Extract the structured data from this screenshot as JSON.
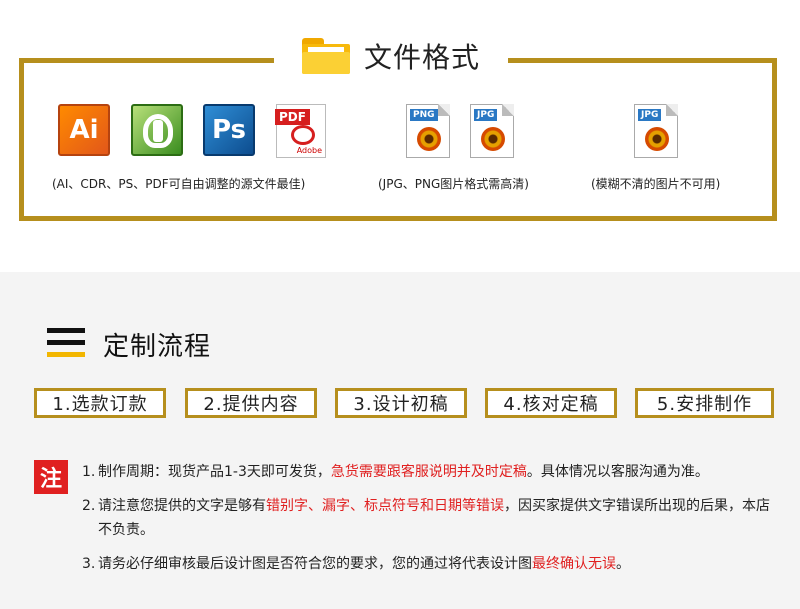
{
  "formats": {
    "title": "文件格式",
    "icons": {
      "ai": "Ai",
      "ps": "Ps",
      "pdf": "PDF",
      "pdf_sub": "Adobe",
      "png1": "PNG",
      "jpg1": "JPG",
      "jpg2": "JPG"
    },
    "captions": [
      "(AI、CDR、PS、PDF可自由调整的源文件最佳)",
      "(JPG、PNG图片格式需高清)",
      "(模糊不清的图片不可用)"
    ]
  },
  "process": {
    "title": "定制流程",
    "steps": [
      "1.选款订款",
      "2.提供内容",
      "3.设计初稿",
      "4.核对定稿",
      "5.安排制作"
    ],
    "note_badge": "注",
    "notes": [
      {
        "num": "1.",
        "parts": [
          "制作周期：现货产品1-3天即可发货，",
          "急货需要跟客服说明并及时定稿",
          "。具体情况以客服沟通为准。"
        ]
      },
      {
        "num": "2.",
        "parts": [
          "请注意您提供的文字是够有",
          "错别字、漏字、标点符号和日期等错误",
          "，因买家提供文字错误所出现的后果，本店不负责。"
        ]
      },
      {
        "num": "3.",
        "parts": [
          "请务必仔细审核最后设计图是否符合您的要求，您的通过将代表设计图",
          "最终确认无误",
          "。"
        ]
      }
    ]
  },
  "colors": {
    "gold": "#b68f1d",
    "red": "#e02020",
    "accent_yellow": "#f2b600"
  }
}
